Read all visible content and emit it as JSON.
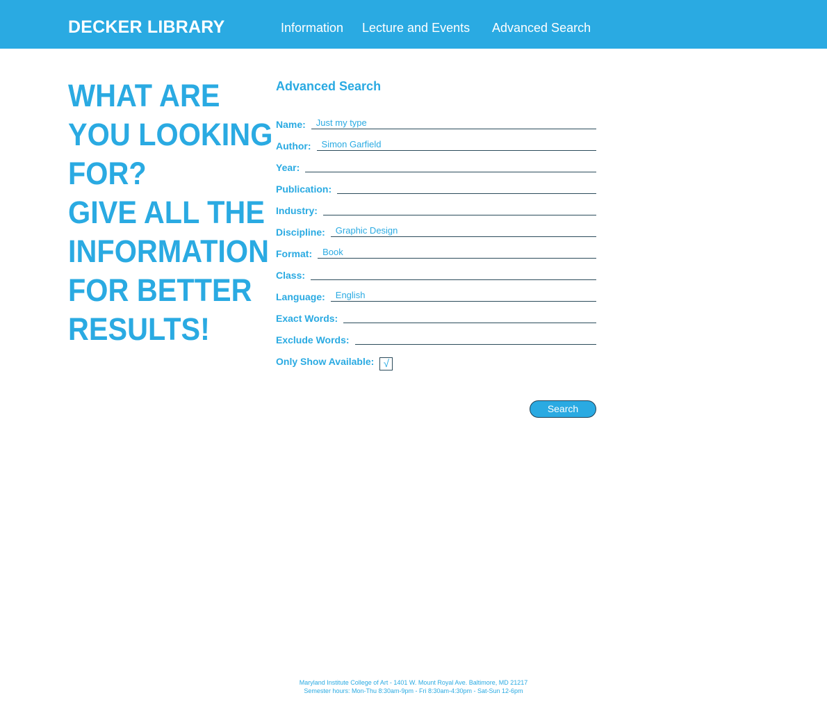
{
  "header": {
    "brand": "DECKER LIBRARY",
    "nav": [
      {
        "label": "Information"
      },
      {
        "label": "Lecture and Events"
      },
      {
        "label": "Advanced Search"
      }
    ]
  },
  "headline": {
    "lines": [
      "WHAT ARE",
      "YOU LOOKING",
      "FOR?",
      "GIVE ALL THE",
      "INFORMATION",
      "FOR BETTER",
      "RESULTS!"
    ]
  },
  "form": {
    "title": "Advanced Search",
    "fields": [
      {
        "label": "Name:",
        "value": "Just my type"
      },
      {
        "label": "Author:",
        "value": "Simon Garfield"
      },
      {
        "label": "Year:",
        "value": ""
      },
      {
        "label": "Publication:",
        "value": ""
      },
      {
        "label": "Industry:",
        "value": ""
      },
      {
        "label": "Discipline:",
        "value": "Graphic Design"
      },
      {
        "label": "Format:",
        "value": "Book"
      },
      {
        "label": "Class:",
        "value": ""
      },
      {
        "label": "Language:",
        "value": "English"
      },
      {
        "label": "Exact Words:",
        "value": ""
      },
      {
        "label": "Exclude Words:",
        "value": ""
      }
    ],
    "available": {
      "label": "Only Show Available:",
      "checked": true,
      "mark": "√"
    },
    "search_label": "Search"
  },
  "footer": {
    "line1": "Maryland Institute College of Art - 1401 W. Mount Royal Ave. Baltimore, MD 21217",
    "line2": "Semester hours: Mon-Thu 8:30am-9pm - Fri 8:30am-4:30pm - Sat-Sun 12-6pm"
  },
  "colors": {
    "accent": "#2aaae2",
    "line": "#2a4a5a"
  }
}
